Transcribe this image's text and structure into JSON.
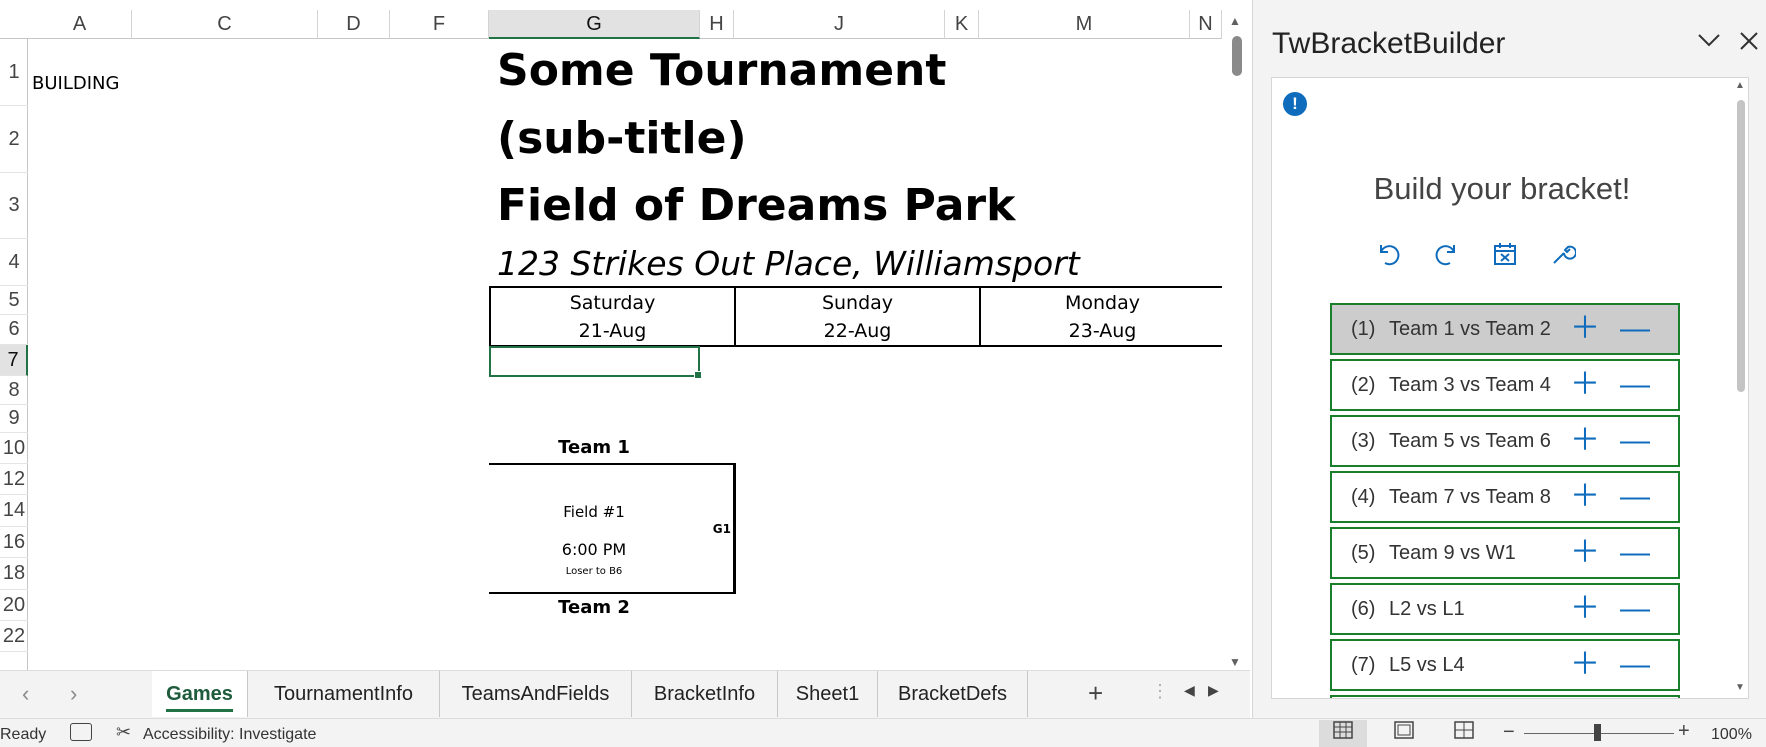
{
  "sheet": {
    "columns": [
      "A",
      "C",
      "D",
      "F",
      "G",
      "H",
      "J",
      "K",
      "M",
      "N"
    ],
    "selected_column": "G",
    "rows": [
      "1",
      "2",
      "3",
      "4",
      "5",
      "6",
      "7",
      "8",
      "9",
      "10",
      "12",
      "14",
      "16",
      "18",
      "20",
      "22"
    ],
    "selected_row": "7",
    "building": "BUILDING",
    "title": "Some Tournament",
    "subtitle": "(sub-title)",
    "venue": "Field of Dreams Park",
    "address": "123 Strikes Out Place, Williamsport",
    "days": [
      {
        "name": "Saturday",
        "date": "21-Aug"
      },
      {
        "name": "Sunday",
        "date": "22-Aug"
      },
      {
        "name": "Monday",
        "date": "23-Aug"
      }
    ],
    "game": {
      "team_top": "Team 1",
      "team_bottom": "Team 2",
      "field": "Field #1",
      "time": "6:00 PM",
      "loser_note": "Loser to B6",
      "id": "G1"
    }
  },
  "tabs": {
    "items": [
      "Games",
      "TournamentInfo",
      "TeamsAndFields",
      "BracketInfo",
      "Sheet1",
      "BracketDefs"
    ],
    "active": "Games",
    "add_label": "+"
  },
  "pane": {
    "title": "TwBracketBuilder",
    "heading": "Build your bracket!",
    "info_icon": "!",
    "tools": [
      "undo-icon",
      "redo-icon",
      "clear-calendar-icon",
      "wrench-icon"
    ],
    "games": [
      {
        "num": "(1)",
        "name": "Team 1 vs Team 2",
        "selected": true
      },
      {
        "num": "(2)",
        "name": "Team 3 vs Team 4",
        "selected": false
      },
      {
        "num": "(3)",
        "name": "Team 5 vs Team 6",
        "selected": false
      },
      {
        "num": "(4)",
        "name": "Team 7 vs Team 8",
        "selected": false
      },
      {
        "num": "(5)",
        "name": "Team 9 vs W1",
        "selected": false
      },
      {
        "num": "(6)",
        "name": "L2 vs L1",
        "selected": false
      },
      {
        "num": "(7)",
        "name": "L5 vs L4",
        "selected": false
      }
    ]
  },
  "status": {
    "ready": "Ready",
    "accessibility": "Accessibility: Investigate",
    "zoom": "100%"
  },
  "colors": {
    "excel_green": "#217346",
    "game_border": "#1a7f2a",
    "accent_blue": "#0f6cbd",
    "selected_game_bg": "#cccccc"
  }
}
